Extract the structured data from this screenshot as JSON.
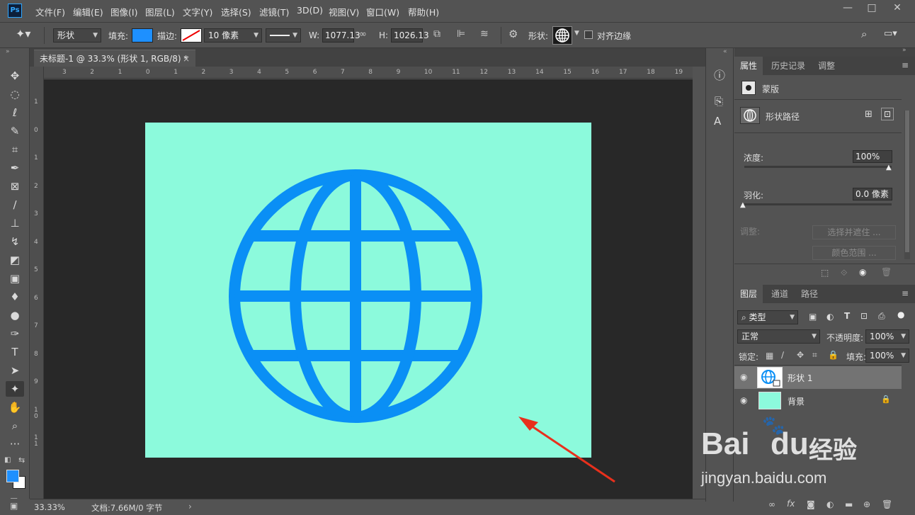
{
  "app": {
    "logo": "Ps"
  },
  "menu": [
    "文件(F)",
    "编辑(E)",
    "图像(I)",
    "图层(L)",
    "文字(Y)",
    "选择(S)",
    "滤镜(T)",
    "3D(D)",
    "视图(V)",
    "窗口(W)",
    "帮助(H)"
  ],
  "window_controls": {
    "minimize": "—",
    "maximize": "□",
    "close": "✕"
  },
  "options": {
    "mode": "形状",
    "fill_label": "填充:",
    "fill_color": "#1e90ff",
    "stroke_label": "描边:",
    "stroke_width": "10 像素",
    "w_label": "W:",
    "w_value": "1077.13",
    "h_label": "H:",
    "h_value": "1026.13",
    "shape_label": "形状:",
    "align_edges": "对齐边缘"
  },
  "document": {
    "tab_title": "未标题-1 @ 33.3% (形状 1, RGB/8) *",
    "tab_close": "×",
    "zoom": "33.33%",
    "doc_info": "文档:7.66M/0 字节",
    "canvas_bg": "#8cfadc",
    "shape_color": "#0a8ff5"
  },
  "ruler_h": [
    "3",
    "2",
    "1",
    "0",
    "1",
    "2",
    "3",
    "4",
    "5",
    "6",
    "7",
    "8",
    "9",
    "10",
    "11",
    "12",
    "13",
    "14",
    "15",
    "16",
    "17",
    "18",
    "19"
  ],
  "ruler_v": [
    "1",
    "0",
    "1",
    "2",
    "3",
    "4",
    "5",
    "6",
    "7",
    "8",
    "9",
    "1 0",
    "1 1"
  ],
  "properties": {
    "tabs": [
      "属性",
      "历史记录",
      "调整"
    ],
    "mask_label": "蒙版",
    "path_label": "形状路径",
    "density_label": "浓度:",
    "density_value": "100%",
    "feather_label": "羽化:",
    "feather_value": "0.0 像素",
    "adjust_label": "调整:",
    "select_mask_btn": "选择并遮住 ...",
    "color_range_btn": "颜色范围 ..."
  },
  "layers": {
    "tabs": [
      "图层",
      "通道",
      "路径"
    ],
    "filter_kind": "类型",
    "blend_mode": "正常",
    "opacity_label": "不透明度:",
    "opacity_value": "100%",
    "lock_label": "锁定:",
    "fill_label": "填充:",
    "fill_value": "100%",
    "items": [
      {
        "name": "形状 1",
        "selected": true
      },
      {
        "name": "背景",
        "selected": false,
        "locked": true,
        "thumb_color": "#8cfadc"
      }
    ]
  },
  "watermark": {
    "logo": "Bai",
    "logo2": "du",
    "brand": "经验",
    "url": "jingyan.baidu.com"
  },
  "annotation_color": "#e8301c"
}
